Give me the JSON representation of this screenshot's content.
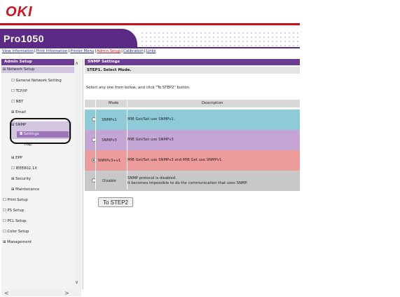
{
  "brand": {
    "logo_text": "OKI",
    "red": "#c8101a",
    "purple": "#5b2a86"
  },
  "header": {
    "title": "Pro1050"
  },
  "nav": {
    "items": [
      {
        "label": "View Information"
      },
      {
        "label": "Print Information"
      },
      {
        "label": "Printer Menu"
      },
      {
        "label": "Admin Setup"
      },
      {
        "label": "Calibration"
      },
      {
        "label": "Links"
      }
    ],
    "separator": "|"
  },
  "sidebar": {
    "header": "Admin Setup",
    "network_setup": "Network Setup",
    "general_network_setting": "General Network Setting",
    "tcpip": "TCP/IP",
    "nbt": "NBT",
    "email": "Email",
    "snmp": "SNMP",
    "settings": "Settings",
    "trap": "Trap",
    "epp": "EPP",
    "ieee": "IEEE802.1X",
    "security": "Security",
    "maintenance": "Maintenance",
    "print_setup": "Print Setup",
    "ps_setup": "PS Setup",
    "pcl_setup": "PCL Setup",
    "color_setup": "Color Setup",
    "management": "Management"
  },
  "main": {
    "section_title": "SNMP Settings",
    "step_title": "STEP1. Select Mode.",
    "instruction": "Select any one from below, and click \"To STEP2\" button.",
    "columns": {
      "mode": "Mode",
      "description": "Description"
    },
    "rows": [
      {
        "mode": "SNMPv1",
        "desc1": "MIB Get/Set use SNMPv1.",
        "desc2": "",
        "color": "#8ecad7",
        "checked": false
      },
      {
        "mode": "SNMPv3",
        "desc1": "MIB Get/Set use SNMPv3",
        "desc2": "",
        "color": "#c4a6d6",
        "checked": false
      },
      {
        "mode": "SNMPv3+v1",
        "desc1": "MIB Get/Set use SNMPv3 and MIB Get use SNMPv1.",
        "desc2": "",
        "color": "#ee9b9c",
        "checked": true
      },
      {
        "mode": "Disable",
        "desc1": "SNMP protocol is disabled.",
        "desc2": "It becomes impossible to do the communication that uses SNMP.",
        "color": "#c8c8c8",
        "checked": false
      }
    ],
    "button": "To STEP2"
  }
}
